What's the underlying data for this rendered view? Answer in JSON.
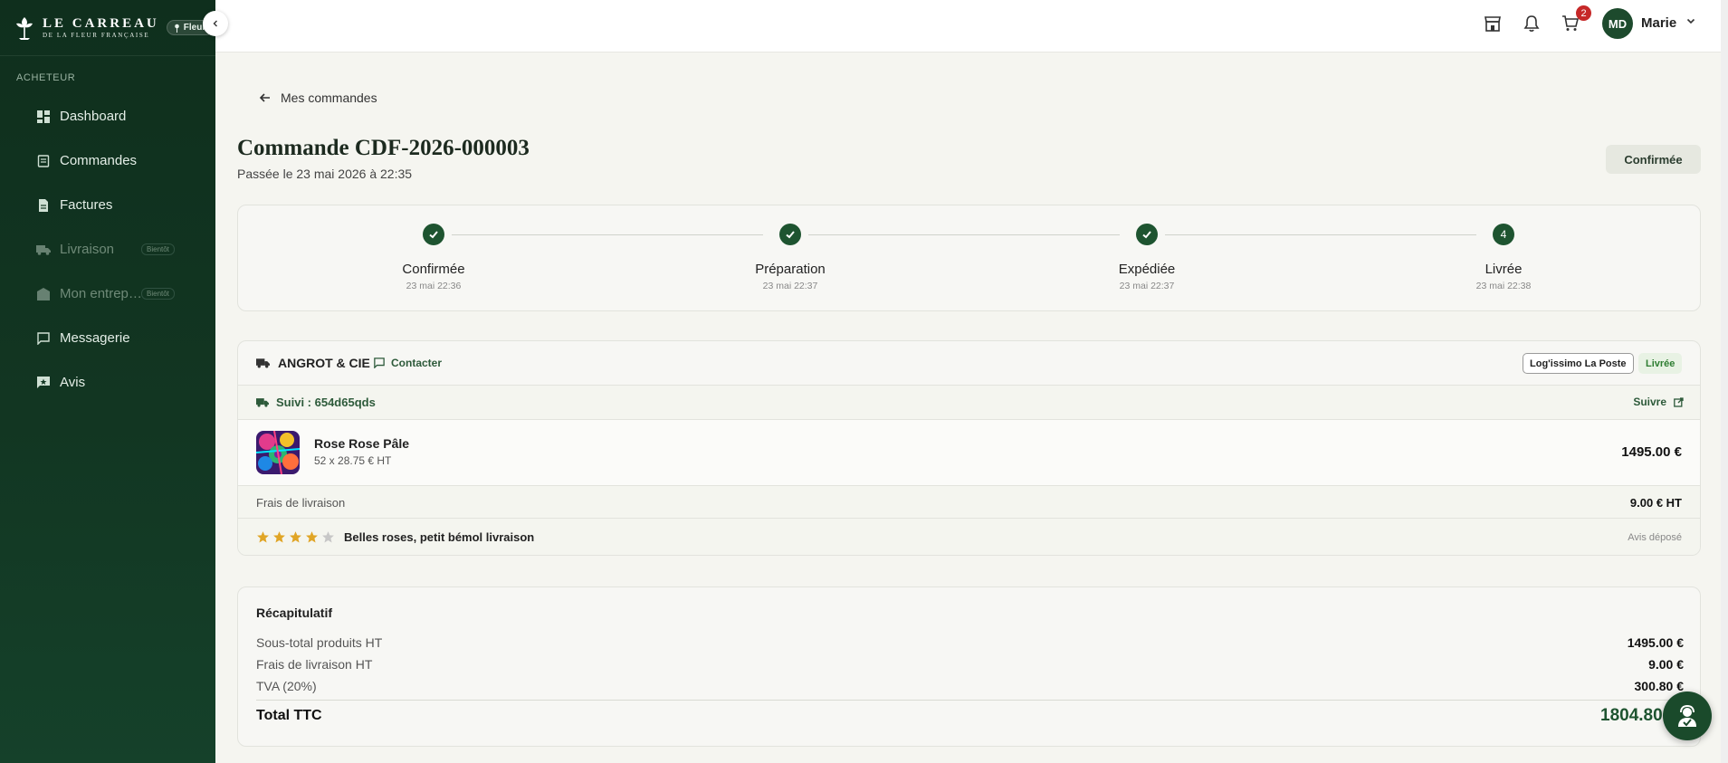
{
  "brand": {
    "name": "LE CARREAU",
    "tagline": "DE LA FLEUR FRANÇAISE",
    "badge": "Fleuri"
  },
  "sidebar": {
    "section": "ACHETEUR",
    "items": [
      {
        "label": "Dashboard",
        "icon": "dashboard-icon",
        "enabled": true
      },
      {
        "label": "Commandes",
        "icon": "orders-icon",
        "enabled": true
      },
      {
        "label": "Factures",
        "icon": "invoice-icon",
        "enabled": true
      },
      {
        "label": "Livraison",
        "icon": "truck-icon",
        "enabled": false,
        "badge": "Bientôt"
      },
      {
        "label": "Mon entrep…",
        "icon": "warehouse-icon",
        "enabled": false,
        "badge": "Bientôt"
      },
      {
        "label": "Messagerie",
        "icon": "message-icon",
        "enabled": true
      },
      {
        "label": "Avis",
        "icon": "review-icon",
        "enabled": true
      }
    ]
  },
  "topbar": {
    "cart_count": "2",
    "user_initials": "MD",
    "user_name": "Marie"
  },
  "order": {
    "back_label": "Mes commandes",
    "title": "Commande CDF-2026-000003",
    "placed": "Passée le 23 mai 2026 à 22:35",
    "status": "Confirmée"
  },
  "steps": [
    {
      "label": "Confirmée",
      "time": "23 mai 22:36",
      "done": true,
      "number": "1"
    },
    {
      "label": "Préparation",
      "time": "23 mai 22:37",
      "done": true,
      "number": "2"
    },
    {
      "label": "Expédiée",
      "time": "23 mai 22:37",
      "done": true,
      "number": "3"
    },
    {
      "label": "Livrée",
      "time": "23 mai 22:38",
      "done": false,
      "number": "4"
    }
  ],
  "supplier": {
    "name": "ANGROT & CIE",
    "contact_label": "Contacter",
    "carrier": "Log'issimo La Poste",
    "delivery_status": "Livrée",
    "tracking": "Suivi : 654d65qds",
    "follow_label": "Suivre",
    "product": {
      "name": "Rose Rose Pâle",
      "qty": "52 x 28.75 € HT",
      "total": "1495.00 €"
    },
    "shipping_label": "Frais de livraison",
    "shipping_value": "9.00 € HT",
    "review": {
      "rating": 4,
      "max": 5,
      "text": "Belles roses, petit bémol livraison",
      "status": "Avis déposé"
    }
  },
  "summary": {
    "title": "Récapitulatif",
    "lines": [
      {
        "label": "Sous-total produits HT",
        "value": "1495.00 €"
      },
      {
        "label": "Frais de livraison HT",
        "value": "9.00 €"
      },
      {
        "label": "TVA (20%)",
        "value": "300.80 €"
      }
    ],
    "total_label": "Total TTC",
    "total_value": "1804.80"
  },
  "colors": {
    "sidebar": "#123622",
    "accent": "#1e5430",
    "star": "#e0a526"
  }
}
